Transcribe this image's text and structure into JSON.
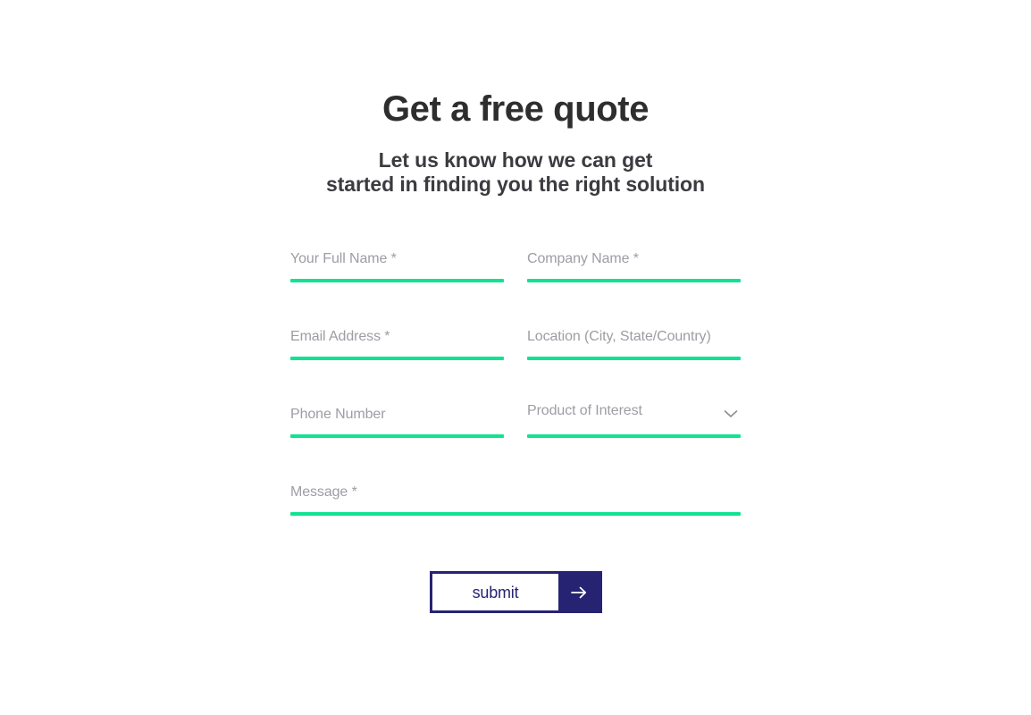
{
  "header": {
    "title": "Get a free quote",
    "subtitle_line1": "Let us know how we can get",
    "subtitle_line2": "started in finding you the right solution"
  },
  "form": {
    "fields": [
      {
        "name": "full-name",
        "placeholder": "Your Full Name *",
        "value": ""
      },
      {
        "name": "company",
        "placeholder": "Company Name *",
        "value": ""
      },
      {
        "name": "email",
        "placeholder": "Email Address *",
        "value": ""
      },
      {
        "name": "location",
        "placeholder": "Location (City, State/Country)",
        "value": ""
      },
      {
        "name": "phone",
        "placeholder": "Phone Number",
        "value": ""
      },
      {
        "name": "message",
        "placeholder": "Message *",
        "value": ""
      }
    ],
    "product_select": {
      "label": "Product of Interest",
      "selected": "Product of Interest",
      "icon": "chevron-down-icon"
    },
    "submit": {
      "label": "submit",
      "icon": "arrow-right-icon"
    }
  },
  "colors": {
    "accent_green": "#10e391",
    "navy": "#262372",
    "heading": "#2e2e2e",
    "subheading": "#3b3b40",
    "placeholder": "#9d9da4",
    "background": "#ffffff"
  }
}
